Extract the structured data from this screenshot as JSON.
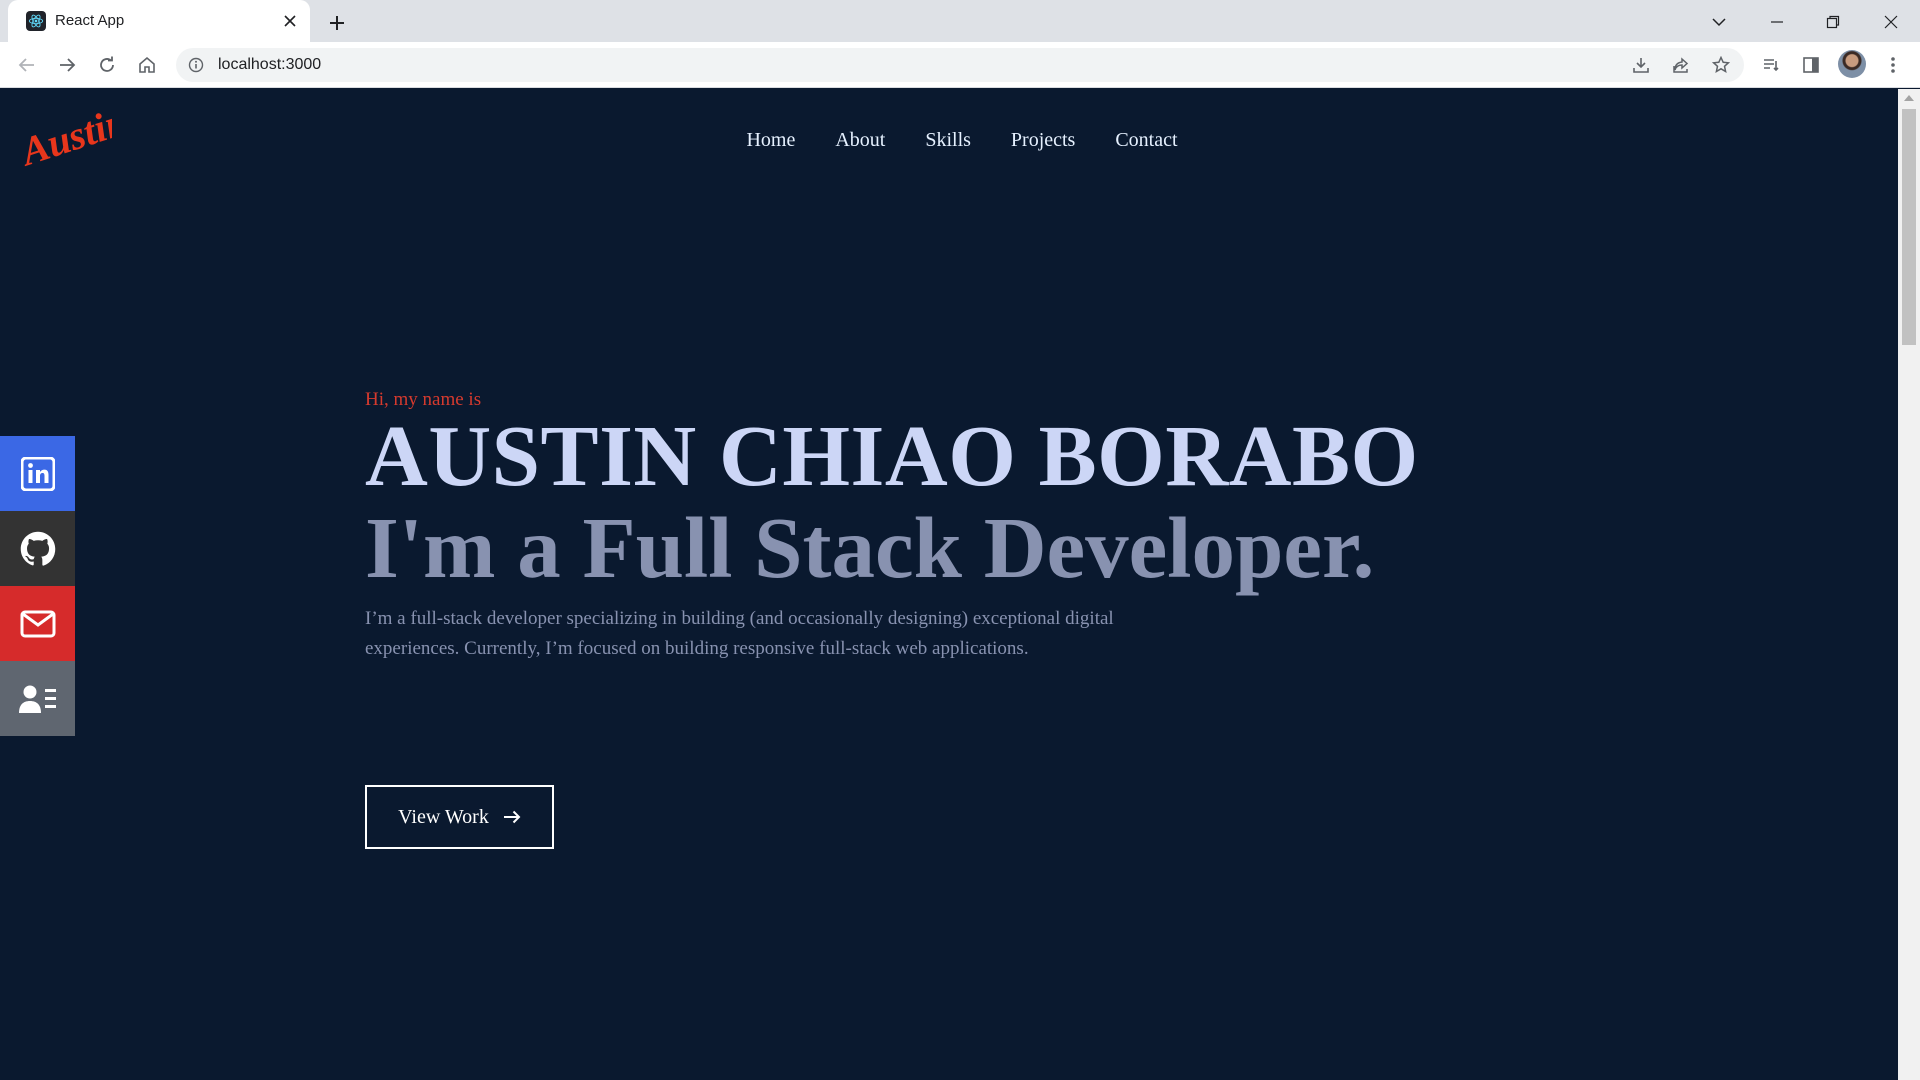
{
  "browser": {
    "tab_title": "React App",
    "url": "localhost:3000"
  },
  "nav": {
    "items": [
      "Home",
      "About",
      "Skills",
      "Projects",
      "Contact"
    ]
  },
  "social": [
    {
      "icon": "linkedin-icon",
      "color": "#3b68e5"
    },
    {
      "icon": "github-icon",
      "color": "#333333"
    },
    {
      "icon": "mail-icon",
      "color": "#d62b2b"
    },
    {
      "icon": "resume-icon",
      "color": "#5f6670"
    }
  ],
  "hero": {
    "greeting": "Hi, my name is",
    "name": "AUSTIN CHIAO BORABO",
    "role": "I'm a Full Stack Developer.",
    "description": "I’m a full-stack developer specializing in building (and occasionally designing) exceptional digital experiences. Currently, I’m focused on building responsive full-stack web applications.",
    "button_label": "View Work"
  },
  "logo": {
    "text": "Austin",
    "color": "#e8361c"
  },
  "colors": {
    "background": "#0a192f",
    "accent": "#d63a2e",
    "heading": "#ccd6f6",
    "muted": "#8892b0"
  }
}
